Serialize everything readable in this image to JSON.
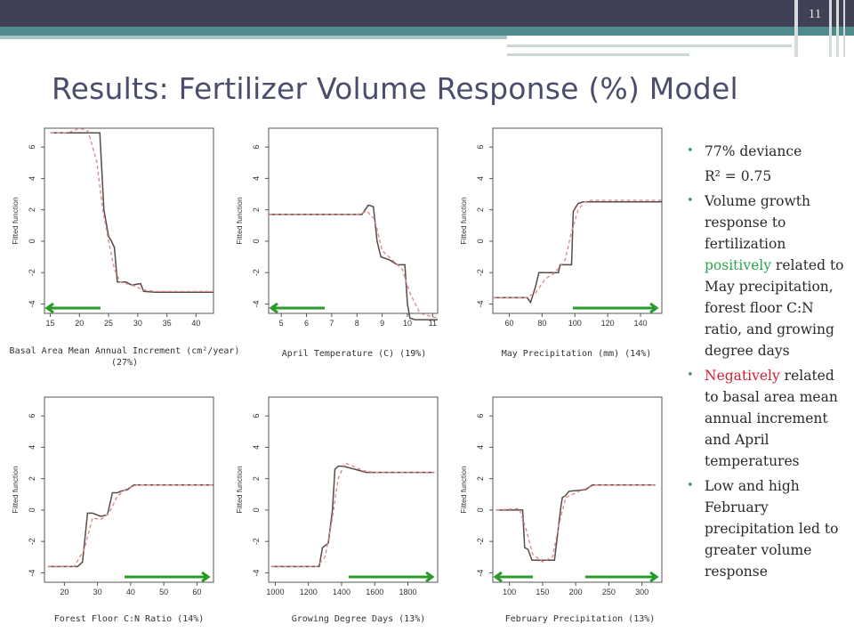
{
  "slide": {
    "number": "11",
    "title": "Results: Fertilizer Volume Response (%) Model"
  },
  "chart_data": [
    {
      "type": "line",
      "ylabel": "Fitted function",
      "caption": "Basal Area Mean Annual Increment (cm²/year) (27%)",
      "xlim": [
        14,
        43
      ],
      "ylim": [
        -4.6,
        7.2
      ],
      "xticks": [
        15,
        20,
        25,
        30,
        35,
        40
      ],
      "yticks": [
        -4,
        -2,
        0,
        2,
        4,
        6
      ],
      "arrow": "left",
      "series": [
        {
          "style": "solid",
          "x": [
            15,
            22,
            23.5,
            24.2,
            25,
            25.5,
            26,
            26.5,
            28,
            29,
            30.5,
            31,
            33,
            35,
            43
          ],
          "y": [
            6.9,
            6.9,
            6.9,
            2.0,
            0.3,
            0.0,
            -0.4,
            -2.6,
            -2.6,
            -2.8,
            -2.7,
            -3.2,
            -3.25,
            -3.25,
            -3.25
          ]
        },
        {
          "style": "dashed",
          "x": [
            15,
            18,
            20,
            21.5,
            23,
            24,
            25,
            26,
            27,
            29,
            31,
            33,
            35,
            43
          ],
          "y": [
            6.9,
            6.9,
            7.2,
            7.0,
            5.0,
            2.0,
            0.0,
            -1.8,
            -2.6,
            -2.8,
            -3.1,
            -3.2,
            -3.2,
            -3.2
          ]
        }
      ]
    },
    {
      "type": "line",
      "ylabel": "Fitted function",
      "caption": "April Temperature (C) (19%)",
      "xlim": [
        4.5,
        11.2
      ],
      "ylim": [
        -4.6,
        7.2
      ],
      "xticks": [
        5,
        6,
        7,
        8,
        9,
        10,
        11
      ],
      "yticks": [
        -4,
        -2,
        0,
        2,
        4,
        6
      ],
      "arrow": "left",
      "series": [
        {
          "style": "solid",
          "x": [
            4.5,
            8.2,
            8.45,
            8.65,
            8.8,
            8.95,
            9.3,
            9.6,
            9.9,
            10.0,
            10.1,
            10.3,
            11.2
          ],
          "y": [
            1.7,
            1.7,
            2.3,
            2.2,
            0.0,
            -1.0,
            -1.2,
            -1.5,
            -1.5,
            -4.0,
            -4.9,
            -5.0,
            -5.0
          ]
        },
        {
          "style": "dashed",
          "x": [
            4.5,
            8.0,
            8.4,
            8.7,
            9.0,
            9.4,
            9.8,
            10.1,
            10.5,
            11.2
          ],
          "y": [
            1.7,
            1.7,
            1.9,
            1.4,
            -0.6,
            -1.2,
            -1.8,
            -3.3,
            -4.6,
            -4.9
          ]
        }
      ]
    },
    {
      "type": "line",
      "ylabel": "Fitted function",
      "caption": "May Precipitation (mm) (14%)",
      "xlim": [
        50,
        153
      ],
      "ylim": [
        -4.6,
        7.2
      ],
      "xticks": [
        60,
        80,
        100,
        120,
        140
      ],
      "yticks": [
        -4,
        -2,
        0,
        2,
        4,
        6
      ],
      "arrow": "right",
      "series": [
        {
          "style": "solid",
          "x": [
            50,
            71,
            73,
            76,
            78,
            80,
            90,
            91,
            98,
            99,
            102,
            105,
            110,
            153
          ],
          "y": [
            -3.6,
            -3.6,
            -3.9,
            -2.9,
            -2.0,
            -2.0,
            -2.0,
            -1.5,
            -1.5,
            1.9,
            2.4,
            2.5,
            2.5,
            2.5
          ]
        },
        {
          "style": "dashed",
          "x": [
            50,
            70,
            76,
            82,
            88,
            94,
            98,
            102,
            106,
            110,
            153
          ],
          "y": [
            -3.6,
            -3.6,
            -3.3,
            -2.4,
            -2.0,
            -1.2,
            0.6,
            2.0,
            2.5,
            2.6,
            2.6
          ]
        }
      ]
    },
    {
      "type": "line",
      "ylabel": "Fitted function",
      "caption": "Forest Floor C:N Ratio (14%)",
      "xlim": [
        14,
        65
      ],
      "ylim": [
        -4.6,
        7.2
      ],
      "xticks": [
        20,
        30,
        40,
        50,
        60
      ],
      "yticks": [
        -4,
        -2,
        0,
        2,
        4,
        6
      ],
      "arrow": "right",
      "series": [
        {
          "style": "solid",
          "x": [
            15,
            24,
            25.5,
            27,
            28.5,
            31,
            33,
            34.5,
            36,
            37,
            39,
            41,
            65
          ],
          "y": [
            -3.6,
            -3.6,
            -3.3,
            -0.2,
            -0.2,
            -0.4,
            -0.3,
            1.1,
            1.1,
            1.2,
            1.3,
            1.6,
            1.6
          ]
        },
        {
          "style": "dashed",
          "x": [
            15,
            23,
            26,
            28.5,
            31,
            33.5,
            36,
            39,
            42,
            65
          ],
          "y": [
            -3.6,
            -3.6,
            -2.5,
            -0.5,
            -0.6,
            -0.2,
            0.9,
            1.4,
            1.6,
            1.6
          ]
        }
      ]
    },
    {
      "type": "line",
      "ylabel": "Fitted function",
      "caption": "Growing Degree Days (13%)",
      "xlim": [
        960,
        1980
      ],
      "ylim": [
        -4.6,
        7.2
      ],
      "xticks": [
        1000,
        1200,
        1400,
        1600,
        1800
      ],
      "yticks": [
        -4,
        -2,
        0,
        2,
        4,
        6
      ],
      "arrow": "right",
      "series": [
        {
          "style": "solid",
          "x": [
            975,
            1265,
            1285,
            1320,
            1345,
            1360,
            1380,
            1410,
            1480,
            1550,
            1960
          ],
          "y": [
            -3.6,
            -3.6,
            -2.4,
            -2.1,
            0.0,
            2.6,
            2.8,
            2.8,
            2.6,
            2.4,
            2.4
          ]
        },
        {
          "style": "dashed",
          "x": [
            975,
            1250,
            1300,
            1340,
            1380,
            1420,
            1470,
            1530,
            1600,
            1960
          ],
          "y": [
            -3.6,
            -3.6,
            -3.0,
            -0.8,
            2.0,
            3.0,
            2.8,
            2.5,
            2.4,
            2.4
          ]
        }
      ]
    },
    {
      "type": "line",
      "ylabel": "Fitted function",
      "caption": "February Precipitation (13%)",
      "xlim": [
        75,
        330
      ],
      "ylim": [
        -4.6,
        7.2
      ],
      "xticks": [
        100,
        150,
        200,
        250,
        300
      ],
      "yticks": [
        -4,
        -2,
        0,
        2,
        4,
        6
      ],
      "arrow": "both",
      "series": [
        {
          "style": "solid",
          "x": [
            80,
            120,
            123,
            128,
            134,
            140,
            168,
            170,
            178,
            180,
            184,
            190,
            215,
            225,
            320
          ],
          "y": [
            0.0,
            0.0,
            -2.4,
            -2.5,
            -3.2,
            -3.2,
            -3.2,
            -2.5,
            0.3,
            0.8,
            0.9,
            1.2,
            1.3,
            1.6,
            1.6
          ]
        },
        {
          "style": "dashed",
          "x": [
            80,
            115,
            125,
            135,
            150,
            165,
            175,
            185,
            205,
            230,
            320
          ],
          "y": [
            0.0,
            0.1,
            -1.2,
            -2.8,
            -3.3,
            -3.0,
            -0.9,
            0.8,
            1.2,
            1.6,
            1.6
          ]
        }
      ]
    }
  ],
  "bullets": {
    "b1": "77% deviance",
    "b1_sub": "R² = 0.75",
    "b2_pre": "Volume growth response to fertilization ",
    "b2_colored": "positively",
    "b2_post": " related to May precipitation, forest floor C:N ratio, and growing degree days",
    "b3_colored": "Negatively",
    "b3_post": " related to basal area mean annual increment and April temperatures",
    "b4": "Low and high February precipitation led to greater volume response",
    "bullet_color": "#4f8b8c",
    "positive_color": "#2aa44c",
    "negative_color": "#d01f2e"
  }
}
